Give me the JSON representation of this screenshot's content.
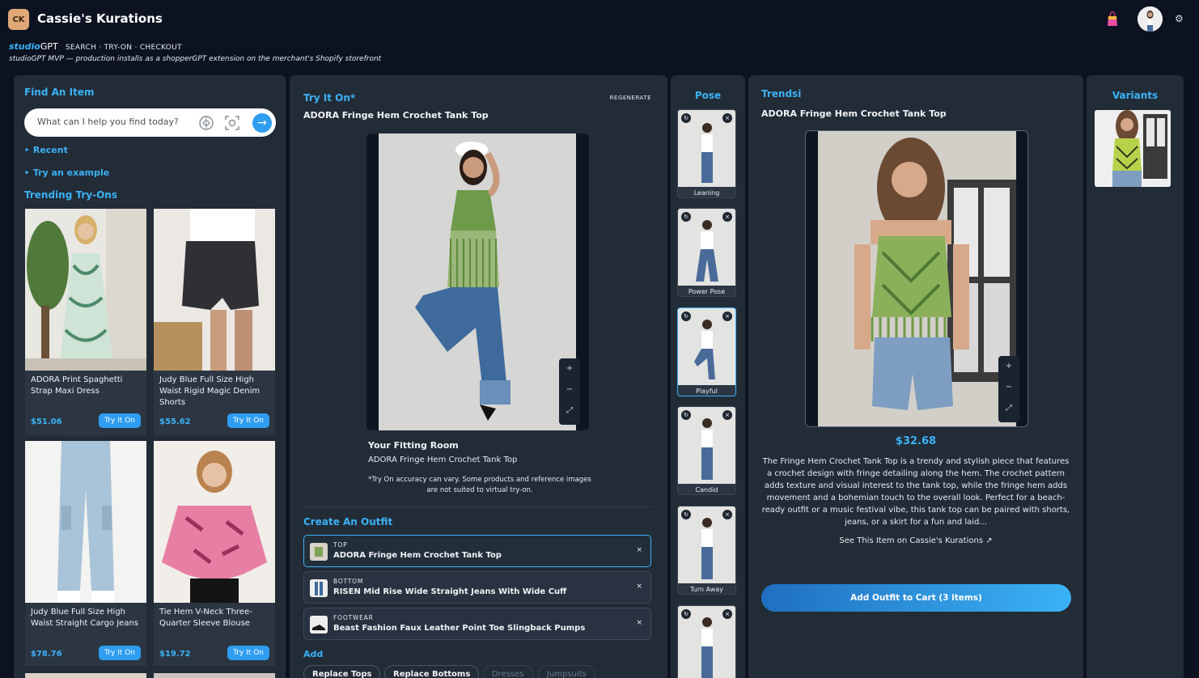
{
  "header": {
    "logo_initials": "CK",
    "app_title": "Cassie's Kurations",
    "brand_studio": "studio",
    "brand_gpt": "GPT",
    "nav": "SEARCH · TRY-ON · CHECKOUT",
    "subtitle": "studioGPT MVP — production installs as a shopperGPT extension on the merchant's Shopify storefront"
  },
  "find": {
    "title": "Find An Item",
    "search_placeholder": "What can I help you find today?",
    "recent_label": "‣ Recent",
    "example_label": "‣ Try an example",
    "trending_title": "Trending Try-Ons",
    "try_label": "Try It On",
    "items": [
      {
        "name": "ADORA Print Spaghetti Strap Maxi Dress",
        "price": "$51.06"
      },
      {
        "name": "Judy Blue Full Size High Waist Rigid Magic Denim Shorts",
        "price": "$55.62"
      },
      {
        "name": "Judy Blue Full Size High Waist Straight Cargo Jeans",
        "price": "$78.76"
      },
      {
        "name": "Tie Hem V-Neck Three-Quarter Sleeve Blouse",
        "price": "$19.72"
      }
    ]
  },
  "tryon": {
    "title": "Try It On*",
    "regenerate": "REGENERATE",
    "product": "ADORA Fringe Hem Crochet Tank Top",
    "fitting_title": "Your Fitting Room",
    "fitting_sub": "ADORA Fringe Hem Crochet Tank Top",
    "disclaimer": "*Try On accuracy can vary. Some products and reference images are not suited to virtual try-on.",
    "zoom": {
      "plus": "+",
      "minus": "−",
      "reset": "⤢"
    }
  },
  "outfit": {
    "title": "Create An Outfit",
    "rows": [
      {
        "kind": "TOP",
        "name": "ADORA Fringe Hem Crochet Tank Top"
      },
      {
        "kind": "BOTTOM",
        "name": "RISEN Mid Rise Wide Straight Jeans With Wide Cuff"
      },
      {
        "kind": "FOOTWEAR",
        "name": "Beast Fashion Faux Leather Point Toe Slingback Pumps"
      }
    ],
    "remove": "×",
    "add_title": "Add",
    "chips": [
      "Replace Tops",
      "Replace Bottoms",
      "Dresses",
      "Jumpsuits"
    ]
  },
  "pose": {
    "title": "Pose",
    "items": [
      "Leaning",
      "Power Pose",
      "Playful",
      "Candid",
      "Turn Away"
    ],
    "ctl_left": "↻",
    "ctl_right": "×"
  },
  "detail": {
    "vendor": "Trendsi",
    "product": "ADORA Fringe Hem Crochet Tank Top",
    "price": "$32.68",
    "description": "The Fringe Hem Crochet Tank Top is a trendy and stylish piece that features a crochet design with fringe detailing along the hem. The crochet pattern adds texture and visual interest to the tank top, while the fringe hem adds movement and a bohemian touch to the overall look. Perfect for a beach-ready outfit or a music festival vibe, this tank top can be paired with shorts, jeans, or a skirt for a fun and laid...",
    "see_link": "See This Item on Cassie's Kurations ↗",
    "cart_button": "Add Outfit to Cart (3 items)"
  },
  "variants": {
    "title": "Variants"
  },
  "colors": {
    "accent": "#3bb2f6",
    "panel": "#222c37",
    "background": "#0c1220"
  }
}
